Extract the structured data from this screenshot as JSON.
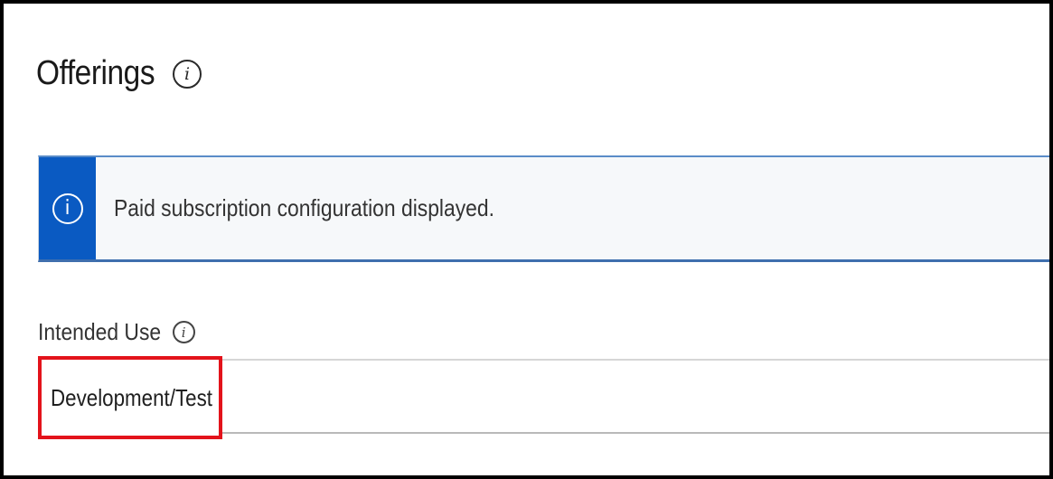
{
  "page": {
    "title": "Offerings",
    "title_info_glyph": "i"
  },
  "banner": {
    "icon": "info-icon",
    "icon_glyph": "i",
    "message": "Paid subscription configuration displayed.",
    "accent_color": "#0a5ac2"
  },
  "intended_use": {
    "label": "Intended Use",
    "info_glyph": "i",
    "value": "Development/Test",
    "highlight_color": "#e3131b"
  }
}
